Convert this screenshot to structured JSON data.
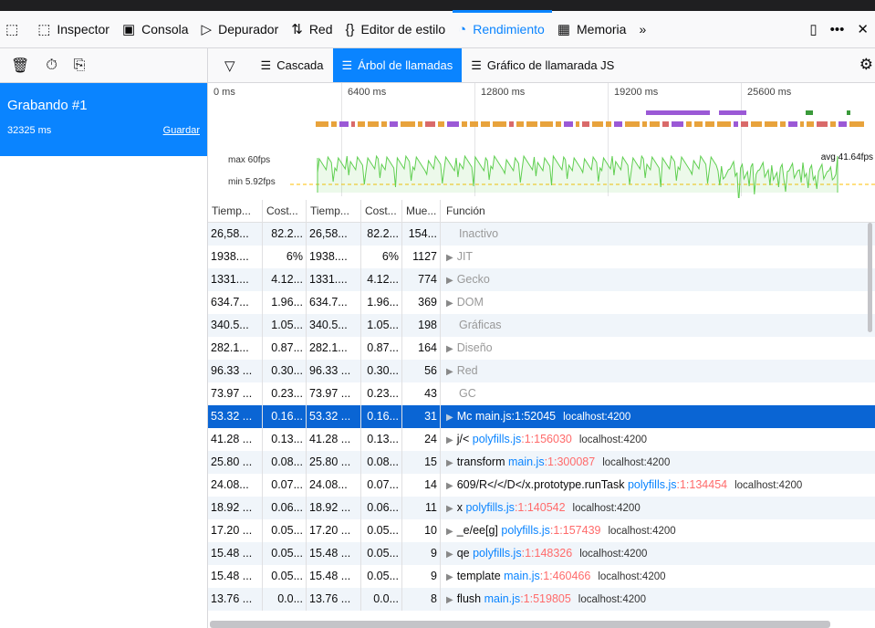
{
  "toolbar": {
    "tabs": [
      {
        "label": "Inspector",
        "icon": "inspector-icon",
        "glyph": "⬚"
      },
      {
        "label": "Consola",
        "icon": "console-icon",
        "glyph": "▣"
      },
      {
        "label": "Depurador",
        "icon": "debugger-icon",
        "glyph": "▷"
      },
      {
        "label": "Red",
        "icon": "network-icon",
        "glyph": "⇅"
      },
      {
        "label": "Editor de estilo",
        "icon": "style-editor-icon",
        "glyph": "{}"
      },
      {
        "label": "Rendimiento",
        "icon": "performance-icon",
        "glyph": "◔",
        "selected": true
      },
      {
        "label": "Memoria",
        "icon": "memory-icon",
        "glyph": "▦"
      }
    ],
    "overflow": "»"
  },
  "sidebar": {
    "recording": {
      "name": "Grabando #1",
      "duration": "32325 ms",
      "save_label": "Guardar"
    }
  },
  "views": {
    "cascade": "Cascada",
    "call_tree": "Árbol de llamadas",
    "flame": "Gráfico de llamarada JS"
  },
  "timeline": {
    "ticks": [
      "0 ms",
      "6400 ms",
      "12800 ms",
      "19200 ms",
      "25600 ms"
    ],
    "fps_max": "max 60fps",
    "fps_min": "min 5.92fps",
    "fps_avg": "avg 41.64fps"
  },
  "table": {
    "headers": [
      "Tiemp...",
      "Cost...",
      "Tiemp...",
      "Cost...",
      "Mue...",
      "Función"
    ],
    "rows": [
      {
        "c1": "26,58...",
        "c2": "82.2...",
        "c3": "26,58...",
        "c4": "82.2...",
        "c5": "154...",
        "name": "Inactivo",
        "twisty": "",
        "gray": true
      },
      {
        "c1": "1938....",
        "c2": "6%",
        "c3": "1938....",
        "c4": "6%",
        "c5": "1127",
        "name": "JIT",
        "twisty": "▶",
        "gray": true
      },
      {
        "c1": "1331....",
        "c2": "4.12...",
        "c3": "1331....",
        "c4": "4.12...",
        "c5": "774",
        "name": "Gecko",
        "twisty": "▶",
        "gray": true
      },
      {
        "c1": "634.7...",
        "c2": "1.96...",
        "c3": "634.7...",
        "c4": "1.96...",
        "c5": "369",
        "name": "DOM",
        "twisty": "▶",
        "gray": true
      },
      {
        "c1": "340.5...",
        "c2": "1.05...",
        "c3": "340.5...",
        "c4": "1.05...",
        "c5": "198",
        "name": "Gráficas",
        "twisty": "",
        "gray": true
      },
      {
        "c1": "282.1...",
        "c2": "0.87...",
        "c3": "282.1...",
        "c4": "0.87...",
        "c5": "164",
        "name": "Diseño",
        "twisty": "▶",
        "gray": true
      },
      {
        "c1": "96.33 ...",
        "c2": "0.30...",
        "c3": "96.33 ...",
        "c4": "0.30...",
        "c5": "56",
        "name": "Red",
        "twisty": "▶",
        "gray": true
      },
      {
        "c1": "73.97 ...",
        "c2": "0.23...",
        "c3": "73.97 ...",
        "c4": "0.23...",
        "c5": "43",
        "name": "GC",
        "twisty": "",
        "gray": true
      },
      {
        "c1": "53.32 ...",
        "c2": "0.16...",
        "c3": "53.32 ...",
        "c4": "0.16...",
        "c5": "31",
        "name": "Mc",
        "file": "main.js",
        "loc": ":1:52045",
        "host": "localhost:4200",
        "twisty": "▶",
        "selected": true
      },
      {
        "c1": "41.28 ...",
        "c2": "0.13...",
        "c3": "41.28 ...",
        "c4": "0.13...",
        "c5": "24",
        "name": "j/<",
        "file": "polyfills.js",
        "loc": ":1:156030",
        "host": "localhost:4200",
        "twisty": "▶"
      },
      {
        "c1": "25.80 ...",
        "c2": "0.08...",
        "c3": "25.80 ...",
        "c4": "0.08...",
        "c5": "15",
        "name": "transform",
        "file": "main.js",
        "loc": ":1:300087",
        "host": "localhost:4200",
        "twisty": "▶"
      },
      {
        "c1": "24.08...",
        "c2": "0.07...",
        "c3": "24.08...",
        "c4": "0.07...",
        "c5": "14",
        "name": "609/R</</D</x.prototype.runTask",
        "file": "polyfills.js",
        "loc": ":1:134454",
        "host": "localhost:4200",
        "twisty": "▶"
      },
      {
        "c1": "18.92 ...",
        "c2": "0.06...",
        "c3": "18.92 ...",
        "c4": "0.06...",
        "c5": "11",
        "name": "x",
        "file": "polyfills.js",
        "loc": ":1:140542",
        "host": "localhost:4200",
        "twisty": "▶"
      },
      {
        "c1": "17.20 ...",
        "c2": "0.05...",
        "c3": "17.20 ...",
        "c4": "0.05...",
        "c5": "10",
        "name": "_e/ee[g]",
        "file": "polyfills.js",
        "loc": ":1:157439",
        "host": "localhost:4200",
        "twisty": "▶"
      },
      {
        "c1": "15.48 ...",
        "c2": "0.05...",
        "c3": "15.48 ...",
        "c4": "0.05...",
        "c5": "9",
        "name": "qe",
        "file": "polyfills.js",
        "loc": ":1:148326",
        "host": "localhost:4200",
        "twisty": "▶"
      },
      {
        "c1": "15.48 ...",
        "c2": "0.05...",
        "c3": "15.48 ...",
        "c4": "0.05...",
        "c5": "9",
        "name": "template",
        "file": "main.js",
        "loc": ":1:460466",
        "host": "localhost:4200",
        "twisty": "▶"
      },
      {
        "c1": "13.76 ...",
        "c2": "0.0...",
        "c3": "13.76 ...",
        "c4": "0.0...",
        "c5": "8",
        "name": "flush",
        "file": "main.js",
        "loc": ":1:519805",
        "host": "localhost:4200",
        "twisty": "▶"
      }
    ]
  },
  "colors": {
    "accent": "#0a84ff",
    "selected_row": "#0a65d4",
    "fps_green": "#5fcf50",
    "marker_orange": "#e8a33c",
    "marker_purple": "#9b59d6"
  }
}
